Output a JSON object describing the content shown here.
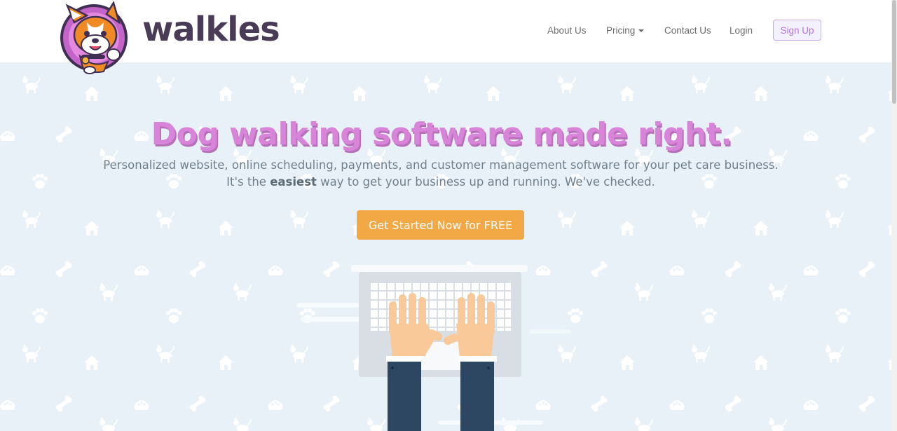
{
  "brand": {
    "name": "walkles",
    "logo": "corgi-mascot-logo"
  },
  "nav": {
    "about": "About Us",
    "pricing": "Pricing",
    "contact": "Contact Us",
    "login": "Login",
    "signup": "Sign Up"
  },
  "hero": {
    "headline": "Dog walking software made right.",
    "subtitle_line1": "Personalized website, online scheduling, payments, and customer management software for your pet care business.",
    "subtitle_line2_before": "It's the",
    "subtitle_line2_bold": "easiest",
    "subtitle_line2_after": "way to get your business up and running. We've checked.",
    "cta": "Get Started Now for FREE",
    "illustration": "hands-typing-on-laptop"
  },
  "colors": {
    "accent_purple": "#d884d9",
    "cta_orange": "#f2a845",
    "hero_bg": "#e8f1f7",
    "brand_dark": "#4a3b57"
  },
  "icons": [
    "dog-pattern-icon",
    "house-pattern-icon",
    "bone-pattern-icon",
    "paw-pattern-icon",
    "dog-bowl-pattern-icon",
    "dropdown-caret-icon"
  ]
}
